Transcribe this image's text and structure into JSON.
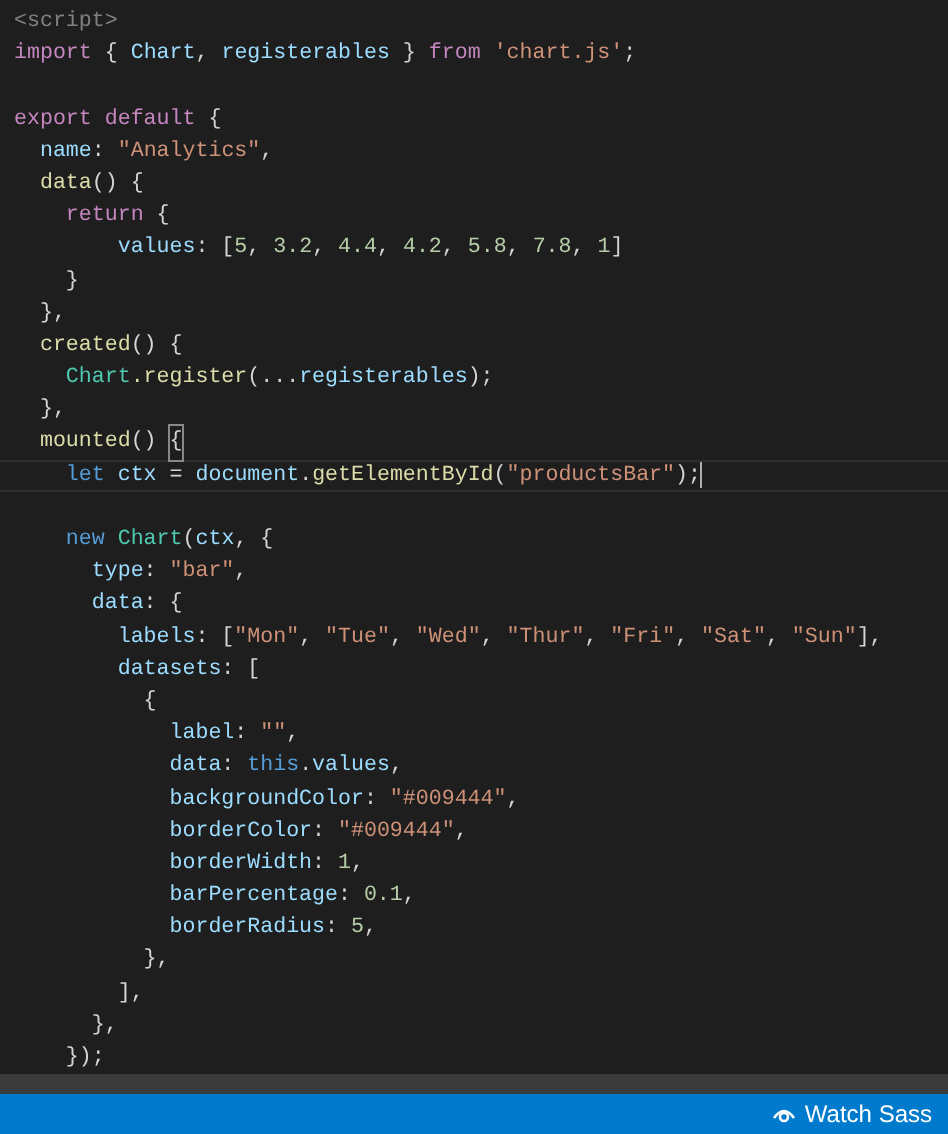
{
  "editor": {
    "lines": [
      {
        "current": false,
        "tokens": [
          {
            "text": "<script>",
            "kind": "tag"
          }
        ]
      },
      {
        "current": false,
        "tokens": [
          {
            "text": "import",
            "kind": "keyword"
          },
          {
            "text": " { ",
            "kind": "punct"
          },
          {
            "text": "Chart",
            "kind": "variable"
          },
          {
            "text": ", ",
            "kind": "punct"
          },
          {
            "text": "registerables",
            "kind": "variable"
          },
          {
            "text": " } ",
            "kind": "punct"
          },
          {
            "text": "from ",
            "kind": "keyword"
          },
          {
            "text": "'chart.js'",
            "kind": "string"
          },
          {
            "text": ";",
            "kind": "punct"
          }
        ]
      },
      {
        "current": false
      },
      {
        "current": false,
        "tokens": [
          {
            "text": "export default",
            "kind": "keyword"
          },
          {
            "text": " {",
            "kind": "punct"
          }
        ]
      },
      {
        "current": false,
        "tokens": [
          {
            "text": "  name",
            "kind": "variable"
          },
          {
            "text": ": ",
            "kind": "punct"
          },
          {
            "text": "\"Analytics\"",
            "kind": "string"
          },
          {
            "text": ",",
            "kind": "punct"
          }
        ]
      },
      {
        "current": false,
        "tokens": [
          {
            "text": "  data",
            "kind": "function"
          },
          {
            "text": "() {",
            "kind": "punct"
          }
        ]
      },
      {
        "current": false,
        "tokens": [
          {
            "text": "    return",
            "kind": "keyword"
          },
          {
            "text": " {",
            "kind": "punct"
          }
        ]
      },
      {
        "current": false,
        "tokens": [
          {
            "text": "        values",
            "kind": "variable"
          },
          {
            "text": ": [",
            "kind": "punct"
          },
          {
            "text": "5",
            "kind": "number"
          },
          {
            "text": ", ",
            "kind": "punct"
          },
          {
            "text": "3.2",
            "kind": "number"
          },
          {
            "text": ", ",
            "kind": "punct"
          },
          {
            "text": "4.4",
            "kind": "number"
          },
          {
            "text": ", ",
            "kind": "punct"
          },
          {
            "text": "4.2",
            "kind": "number"
          },
          {
            "text": ", ",
            "kind": "punct"
          },
          {
            "text": "5.8",
            "kind": "number"
          },
          {
            "text": ", ",
            "kind": "punct"
          },
          {
            "text": "7.8",
            "kind": "number"
          },
          {
            "text": ", ",
            "kind": "punct"
          },
          {
            "text": "1",
            "kind": "number"
          },
          {
            "text": "]",
            "kind": "punct"
          }
        ]
      },
      {
        "current": false,
        "tokens": [
          {
            "text": "    }",
            "kind": "punct"
          }
        ]
      },
      {
        "current": false,
        "tokens": [
          {
            "text": "  },",
            "kind": "punct"
          }
        ]
      },
      {
        "current": false,
        "tokens": [
          {
            "text": "  created",
            "kind": "function"
          },
          {
            "text": "() {",
            "kind": "punct"
          }
        ]
      },
      {
        "current": false,
        "tokens": [
          {
            "text": "    Chart",
            "kind": "class"
          },
          {
            "text": ".register",
            "kind": "function"
          },
          {
            "text": "(...",
            "kind": "punct"
          },
          {
            "text": "registerables",
            "kind": "variable"
          },
          {
            "text": ");",
            "kind": "punct"
          }
        ]
      },
      {
        "current": false,
        "tokens": [
          {
            "text": "  },",
            "kind": "punct"
          }
        ]
      },
      {
        "current": false,
        "tokens": [
          {
            "text": "  mounted",
            "kind": "function"
          },
          {
            "text": "() ",
            "kind": "punct"
          },
          {
            "text": "{",
            "kind": "matched-bracket"
          }
        ]
      },
      {
        "current": true,
        "tokens": [
          {
            "text": "    let ",
            "kind": "storage"
          },
          {
            "text": "ctx",
            "kind": "variable"
          },
          {
            "text": " = ",
            "kind": "punct"
          },
          {
            "text": "document",
            "kind": "variable"
          },
          {
            "text": ".",
            "kind": "punct"
          },
          {
            "text": "getElementById",
            "kind": "function"
          },
          {
            "text": "(",
            "kind": "punct"
          },
          {
            "text": "\"productsBar\"",
            "kind": "string"
          },
          {
            "text": ");",
            "kind": "punct"
          }
        ]
      },
      {
        "current": false
      },
      {
        "current": false,
        "tokens": [
          {
            "text": "    new ",
            "kind": "storage"
          },
          {
            "text": "Chart",
            "kind": "class"
          },
          {
            "text": "(",
            "kind": "punct"
          },
          {
            "text": "ctx",
            "kind": "variable"
          },
          {
            "text": ", {",
            "kind": "punct"
          }
        ]
      },
      {
        "current": false,
        "tokens": [
          {
            "text": "      type",
            "kind": "variable"
          },
          {
            "text": ": ",
            "kind": "punct"
          },
          {
            "text": "\"bar\"",
            "kind": "string"
          },
          {
            "text": ",",
            "kind": "punct"
          }
        ]
      },
      {
        "current": false,
        "tokens": [
          {
            "text": "      data",
            "kind": "variable"
          },
          {
            "text": ": {",
            "kind": "punct"
          }
        ]
      },
      {
        "current": false,
        "tokens": [
          {
            "text": "        labels",
            "kind": "variable"
          },
          {
            "text": ": [",
            "kind": "punct"
          },
          {
            "text": "\"Mon\"",
            "kind": "string"
          },
          {
            "text": ", ",
            "kind": "punct"
          },
          {
            "text": "\"Tue\"",
            "kind": "string"
          },
          {
            "text": ", ",
            "kind": "punct"
          },
          {
            "text": "\"Wed\"",
            "kind": "string"
          },
          {
            "text": ", ",
            "kind": "punct"
          },
          {
            "text": "\"Thur\"",
            "kind": "string"
          },
          {
            "text": ", ",
            "kind": "punct"
          },
          {
            "text": "\"Fri\"",
            "kind": "string"
          },
          {
            "text": ", ",
            "kind": "punct"
          },
          {
            "text": "\"Sat\"",
            "kind": "string"
          },
          {
            "text": ", ",
            "kind": "punct"
          },
          {
            "text": "\"Sun\"",
            "kind": "string"
          },
          {
            "text": "],",
            "kind": "punct"
          }
        ]
      },
      {
        "current": false,
        "tokens": [
          {
            "text": "        datasets",
            "kind": "variable"
          },
          {
            "text": ": [",
            "kind": "punct"
          }
        ]
      },
      {
        "current": false,
        "tokens": [
          {
            "text": "          {",
            "kind": "punct"
          }
        ]
      },
      {
        "current": false,
        "tokens": [
          {
            "text": "            label",
            "kind": "variable"
          },
          {
            "text": ": ",
            "kind": "punct"
          },
          {
            "text": "\"\"",
            "kind": "string"
          },
          {
            "text": ",",
            "kind": "punct"
          }
        ]
      },
      {
        "current": false,
        "tokens": [
          {
            "text": "            data",
            "kind": "variable"
          },
          {
            "text": ": ",
            "kind": "punct"
          },
          {
            "text": "this",
            "kind": "storage"
          },
          {
            "text": ".",
            "kind": "punct"
          },
          {
            "text": "values",
            "kind": "variable"
          },
          {
            "text": ",",
            "kind": "punct"
          }
        ]
      },
      {
        "current": false,
        "tokens": [
          {
            "text": "            backgroundColor",
            "kind": "variable"
          },
          {
            "text": ": ",
            "kind": "punct"
          },
          {
            "text": "\"#009444\"",
            "kind": "string"
          },
          {
            "text": ",",
            "kind": "punct"
          }
        ]
      },
      {
        "current": false,
        "tokens": [
          {
            "text": "            borderColor",
            "kind": "variable"
          },
          {
            "text": ": ",
            "kind": "punct"
          },
          {
            "text": "\"#009444\"",
            "kind": "string"
          },
          {
            "text": ",",
            "kind": "punct"
          }
        ]
      },
      {
        "current": false,
        "tokens": [
          {
            "text": "            borderWidth",
            "kind": "variable"
          },
          {
            "text": ": ",
            "kind": "punct"
          },
          {
            "text": "1",
            "kind": "number"
          },
          {
            "text": ",",
            "kind": "punct"
          }
        ]
      },
      {
        "current": false,
        "tokens": [
          {
            "text": "            barPercentage",
            "kind": "variable"
          },
          {
            "text": ": ",
            "kind": "punct"
          },
          {
            "text": "0.1",
            "kind": "number"
          },
          {
            "text": ",",
            "kind": "punct"
          }
        ]
      },
      {
        "current": false,
        "tokens": [
          {
            "text": "            borderRadius",
            "kind": "variable"
          },
          {
            "text": ": ",
            "kind": "punct"
          },
          {
            "text": "5",
            "kind": "number"
          },
          {
            "text": ",",
            "kind": "punct"
          }
        ]
      },
      {
        "current": false,
        "tokens": [
          {
            "text": "          },",
            "kind": "punct"
          }
        ]
      },
      {
        "current": false,
        "tokens": [
          {
            "text": "        ],",
            "kind": "punct"
          }
        ]
      },
      {
        "current": false,
        "tokens": [
          {
            "text": "      },",
            "kind": "punct"
          }
        ]
      },
      {
        "current": false,
        "tokens": [
          {
            "text": "    });",
            "kind": "punct"
          }
        ]
      }
    ]
  },
  "status_bar": {
    "items": [
      {
        "label": "Watch Sass",
        "kind": "watch"
      }
    ]
  }
}
